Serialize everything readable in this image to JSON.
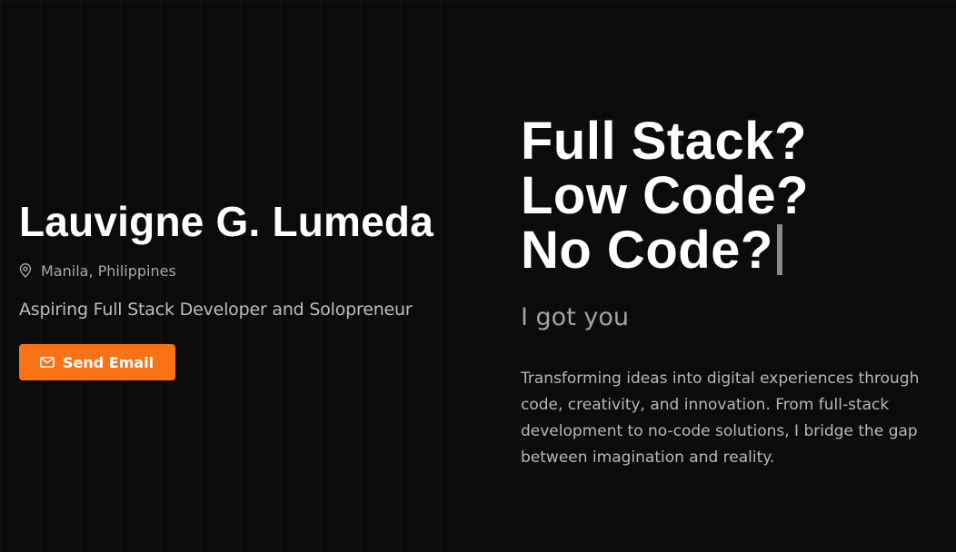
{
  "profile": {
    "name": "Lauvigne G. Lumeda",
    "location": "Manila, Philippines",
    "tagline": "Aspiring Full Stack Developer and Solopreneur",
    "email_button_label": "Send Email",
    "location_icon": "map-pin-icon",
    "email_icon": "mail-icon"
  },
  "hero": {
    "headline_lines": [
      "Full Stack?",
      "Low Code?",
      "No Code?"
    ],
    "subheading": "I got you",
    "description": "Transforming ideas into digital experiences through code, creativity, and innovation. From full-stack development to no-code solutions, I bridge the gap between imagination and reality."
  },
  "colors": {
    "background": "#0b0b0b",
    "accent": "#f97316",
    "text_primary": "#ffffff",
    "text_muted": "#a3a3a3"
  }
}
